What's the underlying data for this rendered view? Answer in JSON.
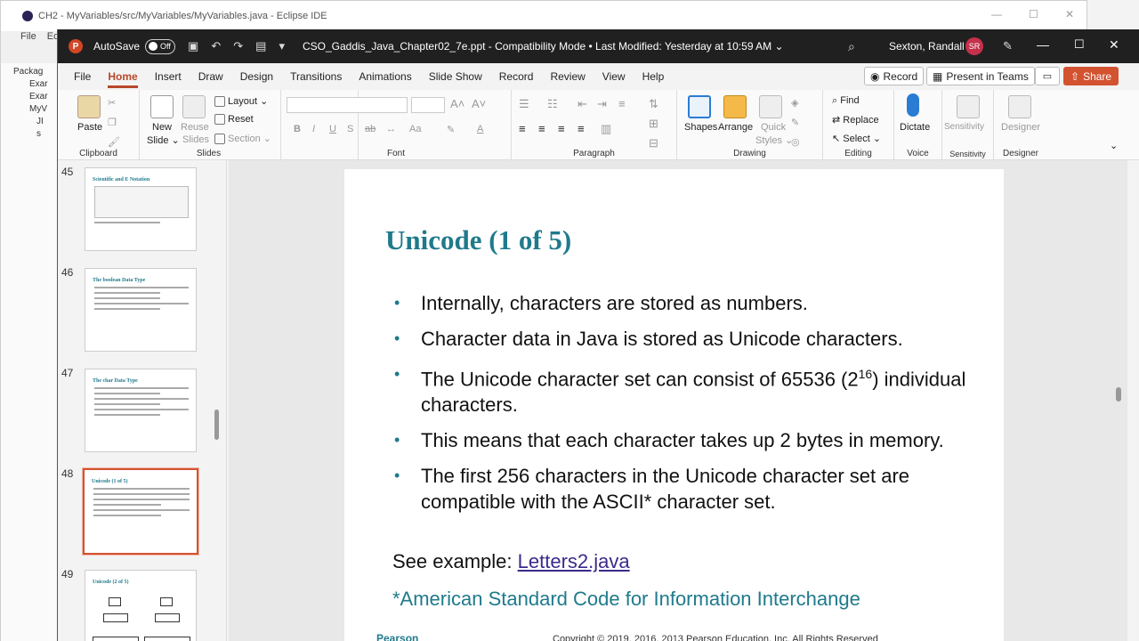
{
  "eclipse": {
    "title": "CH2 - MyVariables/src/MyVariables/MyVariables.java - Eclipse IDE",
    "menu": [
      "File",
      "Edit"
    ],
    "tree": [
      "Packag",
      "Exar",
      "Exar",
      "MyV",
      "JI",
      "s"
    ]
  },
  "ppt": {
    "autosave_label": "AutoSave",
    "autosave_state": "Off",
    "doc_title": "CSO_Gaddis_Java_Chapter02_7e.ppt  -  Compatibility Mode  •  Last Modified: Yesterday at 10:59 AM  ⌄",
    "user_name": "Sexton, Randall S",
    "user_initials": "SR"
  },
  "tabs": [
    "File",
    "Home",
    "Insert",
    "Draw",
    "Design",
    "Transitions",
    "Animations",
    "Slide Show",
    "Record",
    "Review",
    "View",
    "Help"
  ],
  "active_tab": "Home",
  "actions": {
    "record": "Record",
    "present": "Present in Teams",
    "share": "Share"
  },
  "ribbon": {
    "clipboard": {
      "label": "Clipboard",
      "paste": "Paste"
    },
    "slides": {
      "label": "Slides",
      "new_slide": "New",
      "new_slide2": "Slide ⌄",
      "reuse": "Reuse",
      "reuse2": "Slides",
      "layout": "Layout ⌄",
      "reset": "Reset",
      "section": "Section ⌄"
    },
    "font": {
      "label": "Font",
      "bold": "B",
      "italic": "I",
      "underline": "U",
      "shadow": "S",
      "strike": "ab"
    },
    "paragraph": {
      "label": "Paragraph"
    },
    "drawing": {
      "label": "Drawing",
      "shapes": "Shapes",
      "arrange": "Arrange",
      "quick_styles": "Quick",
      "quick_styles2": "Styles ⌄"
    },
    "editing": {
      "label": "Editing",
      "find": "Find",
      "replace": "Replace",
      "select": "Select ⌄"
    },
    "voice": {
      "label": "Voice",
      "dictate": "Dictate"
    },
    "sensitivity": {
      "label": "Sensitivity",
      "button": "Sensitivity"
    },
    "designer": {
      "label": "Designer",
      "button": "Designer"
    }
  },
  "thumbnails": [
    {
      "num": "45",
      "title": "Scientific and E Notation"
    },
    {
      "num": "46",
      "title": "The boolean Data Type"
    },
    {
      "num": "47",
      "title": "The char Data Type"
    },
    {
      "num": "48",
      "title": "Unicode (1 of 5)"
    },
    {
      "num": "49",
      "title": "Unicode (2 of 5)"
    }
  ],
  "slide": {
    "title": "Unicode (1 of 5)",
    "bullets": [
      {
        "text": "Internally, characters are stored as numbers.",
        "sup": "",
        "tail": ""
      },
      {
        "text": "Character data in Java is stored as Unicode characters.",
        "sup": "",
        "tail": ""
      },
      {
        "text": "The Unicode character set can consist of 65536 (2",
        "sup": "16",
        "tail": ") individual characters."
      },
      {
        "text": "This means that each character takes up 2 bytes in memory.",
        "sup": "",
        "tail": ""
      },
      {
        "text": "The first 256 characters in the Unicode character set are compatible with the ASCII* character set.",
        "sup": "",
        "tail": ""
      }
    ],
    "see_prefix": "See example: ",
    "see_link": "Letters2.java",
    "footnote": "*American Standard Code for Information Interchange",
    "footer_logo": "Pearson",
    "footer_copy": "Copyright © 2019, 2016, 2013 Pearson Education, Inc. All Rights Reserved"
  }
}
